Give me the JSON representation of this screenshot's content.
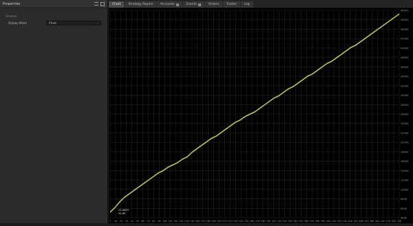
{
  "panel": {
    "title": "Properties",
    "section": "General",
    "property_label": "Display Mode",
    "property_value": "Chart"
  },
  "tabs": [
    {
      "label": "Chart",
      "active": true,
      "badge": false
    },
    {
      "label": "Strategy Report",
      "active": false,
      "badge": false
    },
    {
      "label": "Accounts",
      "active": false,
      "badge": true
    },
    {
      "label": "Events",
      "active": false,
      "badge": true
    },
    {
      "label": "Orders",
      "active": false,
      "badge": false
    },
    {
      "label": "Trades",
      "active": false,
      "badge": false
    },
    {
      "label": "Log",
      "active": false,
      "badge": false
    }
  ],
  "chart_data": {
    "type": "line",
    "series": [
      {
        "values": [
          0.5,
          0.9,
          1.4,
          1.8,
          2.1,
          2.4,
          2.7,
          3.0,
          3.3,
          3.6,
          3.9,
          4.1,
          4.4,
          4.6,
          4.8,
          5.1,
          5.3,
          5.7,
          6.0,
          6.3,
          6.6,
          6.9,
          7.1,
          7.4,
          7.7,
          8.0,
          8.3,
          8.5,
          8.8,
          9.0,
          9.2,
          9.5,
          9.8,
          10.1,
          10.4,
          10.6,
          10.9,
          11.2,
          11.4,
          11.7,
          12.0,
          12.3,
          12.5,
          12.8,
          13.1,
          13.4,
          13.6,
          13.9,
          14.2,
          14.5,
          14.8,
          15.0,
          15.3,
          15.6,
          15.9,
          16.2,
          16.5,
          16.8,
          17.1,
          17.4,
          17.7
        ]
      },
      {
        "values": [
          0.45,
          0.85,
          1.35,
          1.75,
          2.05,
          2.35,
          2.65,
          2.95,
          3.25,
          3.55,
          3.85,
          4.05,
          4.35,
          4.55,
          4.75,
          5.05,
          5.25,
          5.65,
          5.95,
          6.25,
          6.55,
          6.85,
          7.05,
          7.35,
          7.65,
          7.95,
          8.25,
          8.45,
          8.75,
          8.95,
          9.15,
          9.45,
          9.75,
          10.05,
          10.35,
          10.55,
          10.85,
          11.15,
          11.35,
          11.65,
          11.95,
          12.25,
          12.45,
          12.75,
          13.05,
          13.35,
          13.55,
          13.85,
          14.15,
          14.45,
          14.75,
          14.95,
          15.25,
          15.55,
          15.85,
          16.15,
          16.45,
          16.75,
          17.05,
          17.35,
          17.65
        ]
      }
    ],
    "y_ticks": [
      "4000",
      "6000",
      "8000",
      "10000",
      "12000",
      "14000",
      "16000",
      "18000",
      "20000",
      "22000",
      "24000",
      "26000",
      "28000",
      "30000",
      "32000",
      "34000",
      "36000",
      "38000",
      "40000",
      "42000",
      "44000",
      "46000",
      "48000"
    ],
    "x_ticks": [
      "1",
      "10",
      "20",
      "30",
      "40",
      "50",
      "60",
      "70",
      "80",
      "90",
      "100",
      "110",
      "120",
      "130",
      "140",
      "150",
      "160",
      "170",
      "180",
      "190",
      "200",
      "210",
      "220",
      "230",
      "240",
      "250",
      "260",
      "270",
      "280",
      "290",
      "300",
      "310",
      "320",
      "330",
      "340",
      "350",
      "360",
      "370",
      "380",
      "390",
      "400",
      "410",
      "420",
      "430",
      "440",
      "450",
      "460",
      "470",
      "480",
      "490",
      "500",
      "510",
      "520",
      "530"
    ],
    "labels": [
      "21.6959",
      "20.89"
    ],
    "colors": {
      "line_primary": "#d8db47",
      "line_secondary": "#8f8f8f",
      "grid": "#2b2b2b",
      "axis_text": "#9a9a9a",
      "label_bg": "#d8db47"
    },
    "grid": true
  }
}
